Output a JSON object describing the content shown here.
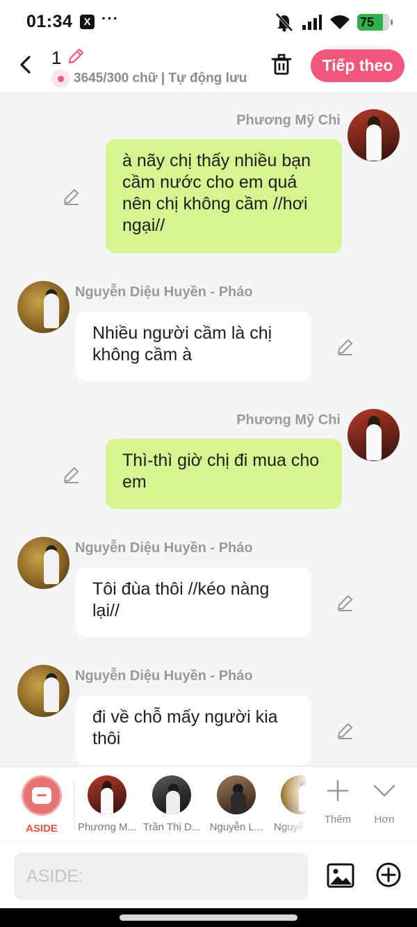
{
  "status_bar": {
    "time": "01:34",
    "x_app_label": "X",
    "more": "···",
    "battery": "75"
  },
  "header": {
    "title": "1",
    "save_status": "3645/300 chữ | Tự động lưu",
    "next_button": "Tiếp theo",
    "accent_color": "#f0577a"
  },
  "messages": [
    {
      "sender": "Phương Mỹ Chi",
      "side": "right",
      "text": "à nãy chị thấy nhiều bạn cầm nước cho em quá nên chị không cầm //hơi ngại//"
    },
    {
      "sender": "Nguyễn Diệu Huyền - Pháo",
      "side": "left",
      "text": "Nhiều người cầm là chị không cầm à"
    },
    {
      "sender": "Phương Mỹ Chi",
      "side": "right",
      "text": "Thì-thì giờ chị đi mua cho em"
    },
    {
      "sender": "Nguyễn Diệu Huyền - Pháo",
      "side": "left",
      "text": "Tôi đùa thôi //kéo nàng lại//"
    },
    {
      "sender": "Nguyễn Diệu Huyền - Pháo",
      "side": "left",
      "text": "đi về chỗ mấy người kia thôi"
    }
  ],
  "characters": {
    "aside": "ASIDE",
    "items": [
      "Phương M...",
      "Trần Thị D...",
      "Nguyễn L...",
      "Nguyễ"
    ],
    "add_label": "Thêm",
    "more_label": "Hơn"
  },
  "input": {
    "placeholder": "ASIDE:"
  }
}
